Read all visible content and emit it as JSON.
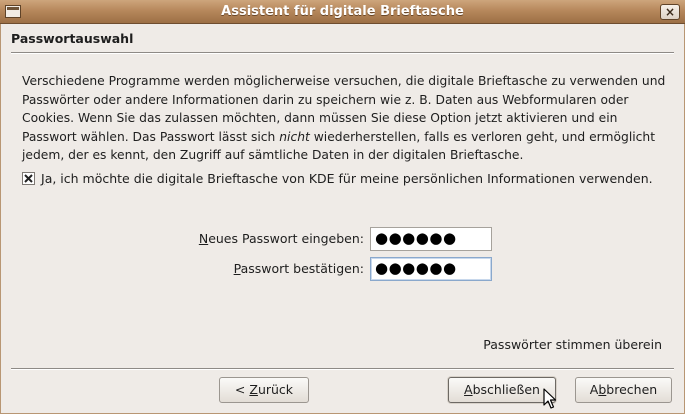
{
  "window": {
    "title": "Assistent für digitale Brieftasche",
    "close_glyph": "×"
  },
  "page": {
    "title": "Passwortauswahl",
    "desc_part1": "Verschiedene Programme werden möglicherweise versuchen, die digitale Brieftasche zu verwenden und Passwörter oder andere Informationen darin zu speichern wie z. B. Daten aus Webformularen oder Cookies. Wenn Sie das zulassen möchten, dann müssen Sie diese Option jetzt aktivieren und ein Passwort wählen. Das Passwort lässt sich ",
    "desc_emphasis": "nicht",
    "desc_part2": " wiederherstellen, falls es verloren geht, und ermöglicht jedem, der es kennt, den Zugriff auf sämtliche Daten in der digitalen Brieftasche."
  },
  "opt_in": {
    "mnemonic": "J",
    "label_rest": "a, ich möchte die digitale Brieftasche von KDE für meine persönlichen Informationen verwenden.",
    "checked": true
  },
  "fields": {
    "new_password": {
      "mnemonic": "N",
      "label_rest": "eues Passwort eingeben:",
      "value": "●●●●●●"
    },
    "confirm_password": {
      "mnemonic": "P",
      "label_rest": "asswort bestätigen:",
      "value": "●●●●●●"
    }
  },
  "status_text": "Passwörter stimmen überein",
  "buttons": {
    "back_prefix": "< ",
    "back_mnemonic": "Z",
    "back_rest": "urück",
    "finish_mnemonic": "A",
    "finish_rest": "bschließen",
    "cancel_prefix": "A",
    "cancel_mnemonic": "b",
    "cancel_rest": "brechen"
  }
}
